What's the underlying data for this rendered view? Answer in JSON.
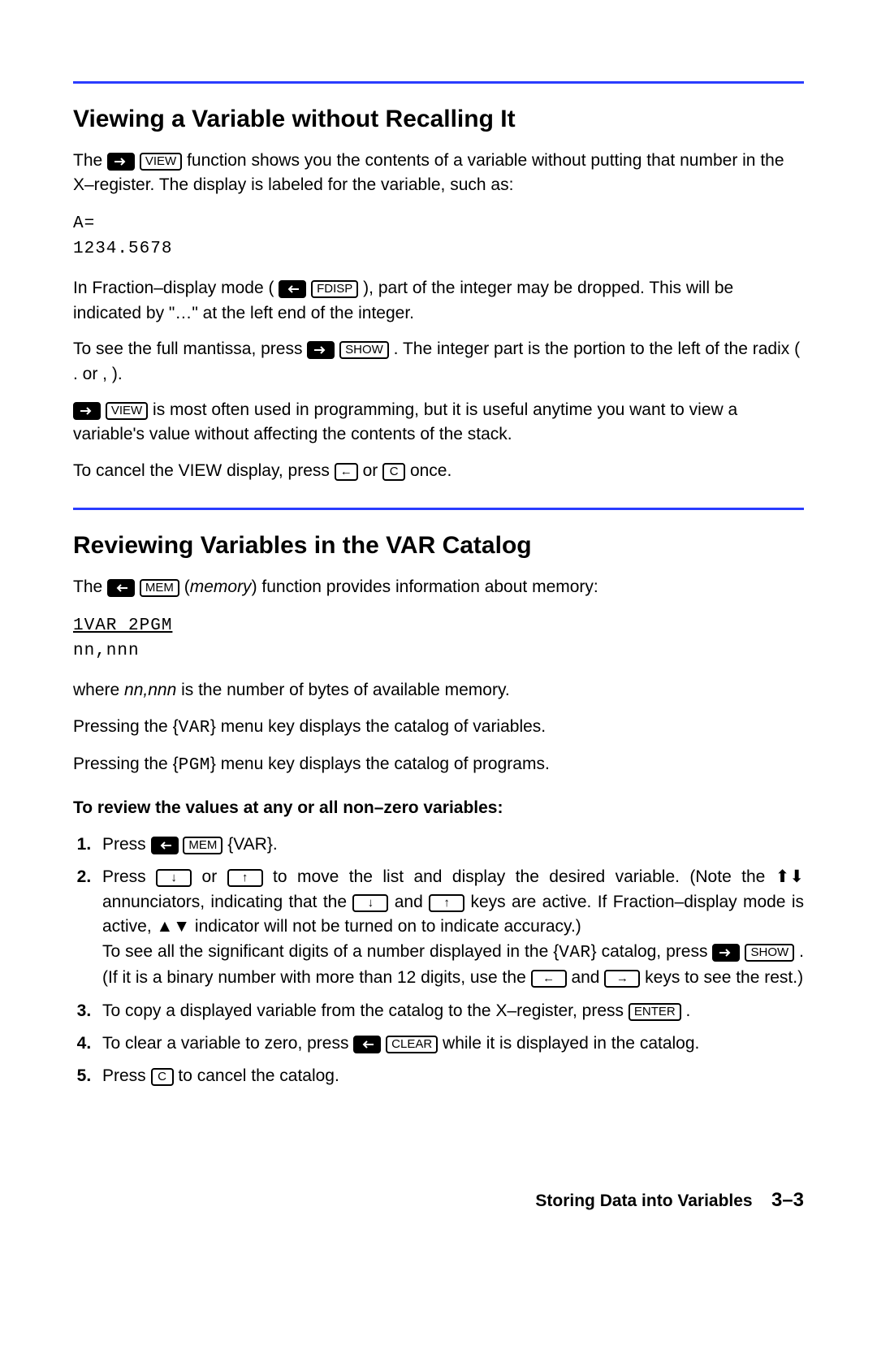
{
  "sections": {
    "s1": {
      "title": "Viewing a Variable without Recalling It",
      "p1a": "The ",
      "p1b": " function shows you the contents of a variable without putting that number in the X–register. The display is labeled for the variable, such as:",
      "display1_l1": "A=",
      "display1_l2": "1234.5678",
      "p2a": "In Fraction–display mode (",
      "p2b": "), part of the integer may be dropped. This will be indicated by \"…\" at the left end of the integer.",
      "p3a": "To see the full mantissa, press ",
      "p3b": ". The integer part is the portion to the left of the radix ( . or , ).",
      "p4a": "",
      "p4b": " is most often used in programming, but it is useful anytime you want to view a variable's value without affecting the contents of the stack.",
      "p5a": "To cancel the VIEW display, press ",
      "p5b": " or ",
      "p5c": " once."
    },
    "s2": {
      "title": "Reviewing Variables in the VAR Catalog",
      "p1a": "The ",
      "p1b": " (",
      "p1c": "memory",
      "p1d": ") function provides information about memory:",
      "display2_l1": "1VAR  2PGM",
      "display2_l2": "nn,nnn",
      "p2a": "where ",
      "p2b": "nn,nnn",
      "p2c": " is the number of bytes of available memory.",
      "p3a": "Pressing the {",
      "p3b": "VAR",
      "p3c": "} menu key displays the catalog of variables.",
      "p4a": "Pressing the {",
      "p4b": "PGM",
      "p4c": "} menu key displays the catalog of programs.",
      "sub": "To review the values at any or all non–zero variables:",
      "li1a": "Press ",
      "li1b": " {VAR}.",
      "li2a": "Press ",
      "li2b": " or ",
      "li2c": " to move the list and display the desired variable. (Note the ",
      "li2d": " annunciators, indicating that the ",
      "li2e": " and ",
      "li2f": " keys are active. If Fraction–display mode is active, ▲▼ indicator will not be turned on to indicate accuracy.)",
      "li2g": "To see all the significant digits of a number displayed in the {",
      "li2h": "VAR",
      "li2i": "} catalog, press ",
      "li2j": ". (If it is a binary number with more than 12 digits, use the ",
      "li2k": " and ",
      "li2l": " keys to see the rest.)",
      "li3a": "To copy a displayed variable from the catalog to the X–register, press ",
      "li3b": ".",
      "li4a": "To clear a variable to zero, press ",
      "li4b": " while it is displayed in the catalog.",
      "li5a": "Press ",
      "li5b": " to cancel the catalog."
    }
  },
  "keys": {
    "view": "VIEW",
    "fdisp": "FDISP",
    "show": "SHOW",
    "mem": "MEM",
    "clear": "CLEAR",
    "enter": "ENTER",
    "c": "C",
    "back": "←",
    "down": "↓",
    "up": "↑",
    "left": "←",
    "right": "→",
    "bigup": "⬆",
    "bigdown": "⬇"
  },
  "footer": {
    "chapter": "Storing Data into Variables",
    "page": "3–3"
  }
}
